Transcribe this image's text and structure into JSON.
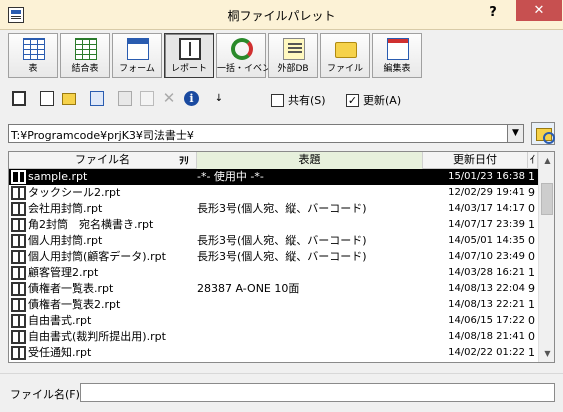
{
  "window": {
    "title": "桐ファイルパレット",
    "help": "?",
    "close": "✕"
  },
  "big_toolbar": [
    {
      "label": "表",
      "icon": "table-icon"
    },
    {
      "label": "結合表",
      "icon": "joined-table-icon"
    },
    {
      "label": "フォーム",
      "icon": "form-icon"
    },
    {
      "label": "レポート",
      "icon": "report-icon",
      "active": true
    },
    {
      "label": "一括・イベント",
      "icon": "batch-event-icon"
    },
    {
      "label": "外部DB",
      "icon": "external-db-icon"
    },
    {
      "label": "ファイル",
      "icon": "file-folder-icon"
    },
    {
      "label": "編集表",
      "icon": "edit-table-icon"
    }
  ],
  "small_toolbar": {
    "share_label": "共有(S)",
    "share_checked": false,
    "refresh_label": "更新(A)",
    "refresh_checked": true,
    "info_glyph": "i",
    "delete_glyph": "✕",
    "sort_glyph": "↓"
  },
  "path": {
    "value": "T:¥Programcode¥prjK3¥司法書士¥",
    "dropdown_glyph": "▼"
  },
  "list": {
    "columns": [
      "ファイル名",
      "表題",
      "更新日付",
      "ｲ"
    ],
    "sort_indicator": "ｦﾘ",
    "rows": [
      {
        "name": "sample.rpt",
        "title": "-*- 使用中 -*-",
        "date": "15/01/23 16:38",
        "extra": "1",
        "selected": true
      },
      {
        "name": "タックシール2.rpt",
        "title": "",
        "date": "12/02/29 19:41",
        "extra": "9"
      },
      {
        "name": "会社用封筒.rpt",
        "title": "長形3号(個人宛、縦、バーコード)",
        "date": "14/03/17 14:17",
        "extra": "0"
      },
      {
        "name": "角2封筒　宛名横書き.rpt",
        "title": "",
        "date": "14/07/17 23:39",
        "extra": "1"
      },
      {
        "name": "個人用封筒.rpt",
        "title": "長形3号(個人宛、縦、バーコード)",
        "date": "14/05/01 14:35",
        "extra": "0"
      },
      {
        "name": "個人用封筒(顧客データ).rpt",
        "title": "長形3号(個人宛、縦、バーコード)",
        "date": "14/07/10 23:49",
        "extra": "0"
      },
      {
        "name": "顧客管理2.rpt",
        "title": "",
        "date": "14/03/28 16:21",
        "extra": "1"
      },
      {
        "name": "債権者一覧表.rpt",
        "title": "28387 A-ONE 10面",
        "date": "14/08/13 22:04",
        "extra": "9"
      },
      {
        "name": "債権者一覧表2.rpt",
        "title": "",
        "date": "14/08/13 22:21",
        "extra": "1"
      },
      {
        "name": "自由書式.rpt",
        "title": "",
        "date": "14/06/15 17:22",
        "extra": "0"
      },
      {
        "name": "自由書式(裁判所提出用).rpt",
        "title": "",
        "date": "14/08/18 21:41",
        "extra": "0"
      },
      {
        "name": "受任通知.rpt",
        "title": "",
        "date": "14/02/22 01:22",
        "extra": "1"
      }
    ],
    "scroll_up_glyph": "▲",
    "scroll_down_glyph": "▼"
  },
  "filename": {
    "label": "ファイル名(F)",
    "value": ""
  }
}
